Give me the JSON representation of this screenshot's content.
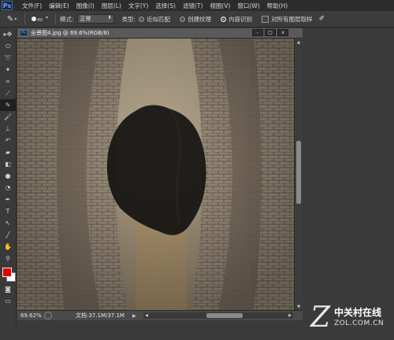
{
  "app": {
    "logo": "Ps"
  },
  "menu": [
    "文件(F)",
    "编辑(E)",
    "图像(I)",
    "图层(L)",
    "文字(Y)",
    "选择(S)",
    "滤镜(T)",
    "视图(V)",
    "窗口(W)",
    "帮助(H)"
  ],
  "options": {
    "brush_size": "40",
    "mode_label": "模式:",
    "mode_value": "正常",
    "type_label": "类型:",
    "radio_options": [
      {
        "label": "近似匹配",
        "selected": false
      },
      {
        "label": "创建纹理",
        "selected": false
      },
      {
        "label": "内容识别",
        "selected": true
      }
    ],
    "sample_all_layers": "对所有图层取样"
  },
  "toolbar": {
    "tools": [
      "move-icon",
      "marquee-icon",
      "lasso-icon",
      "quick-select-icon",
      "crop-icon",
      "eyedropper-icon",
      "spot-healing-brush-icon",
      "brush-icon",
      "clone-stamp-icon",
      "history-brush-icon",
      "eraser-icon",
      "gradient-icon",
      "blur-icon",
      "dodge-icon",
      "pen-icon",
      "type-icon",
      "path-select-icon",
      "shape-icon",
      "hand-icon",
      "zoom-icon"
    ],
    "active_tool": "spot-healing-brush-icon",
    "foreground_color": "#e00000",
    "background_color": "#ffffff"
  },
  "document": {
    "title": "全景图4.jpg @ 69.6%(RGB/8)",
    "window_buttons": [
      "-",
      "□",
      "x"
    ]
  },
  "status": {
    "zoom": "69.62%",
    "doc_size": "文档:37.1M/37.1M"
  },
  "watermark": {
    "brand_cn": "中关村在线",
    "url": "ZOL.COM.CN"
  }
}
